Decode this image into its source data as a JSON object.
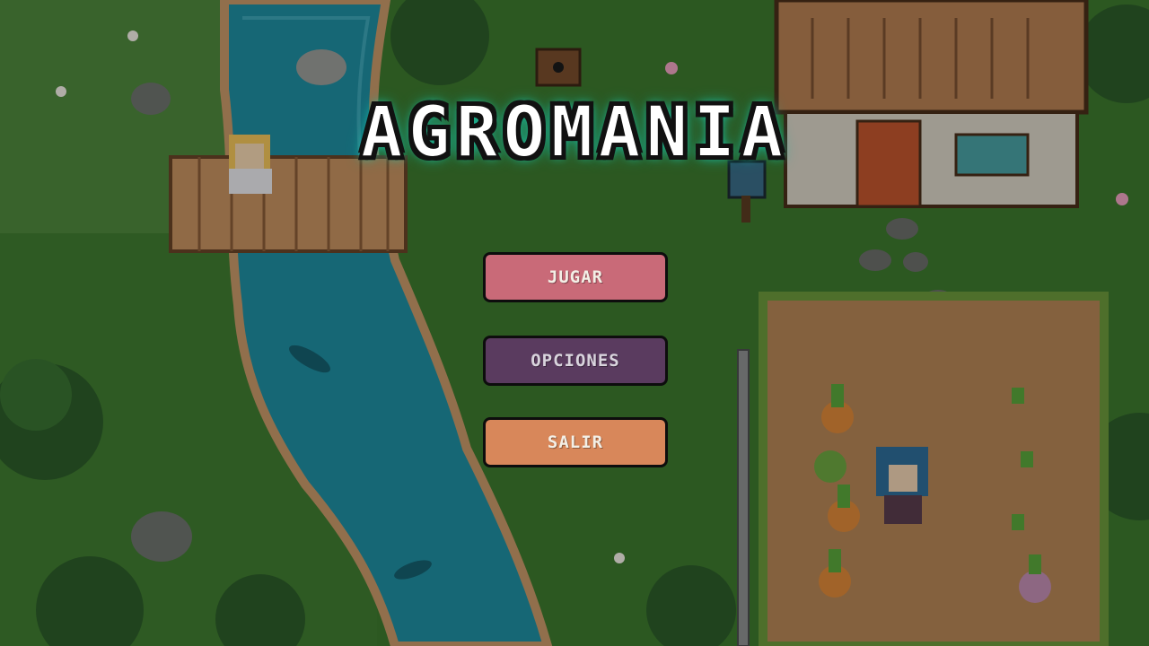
{
  "game": {
    "title": "AGROMANIA",
    "menu": [
      {
        "id": "play",
        "label": "JUGAR",
        "color": "#c96a78"
      },
      {
        "id": "options",
        "label": "OPCIONES",
        "color": "#5a3b5f"
      },
      {
        "id": "exit",
        "label": "SALIR",
        "color": "#d8875a"
      }
    ]
  },
  "colors": {
    "title_glow": "#1de0c4",
    "grass": "#3f7a2e",
    "river": "#2a8ca0",
    "soil": "#b98a5a"
  }
}
